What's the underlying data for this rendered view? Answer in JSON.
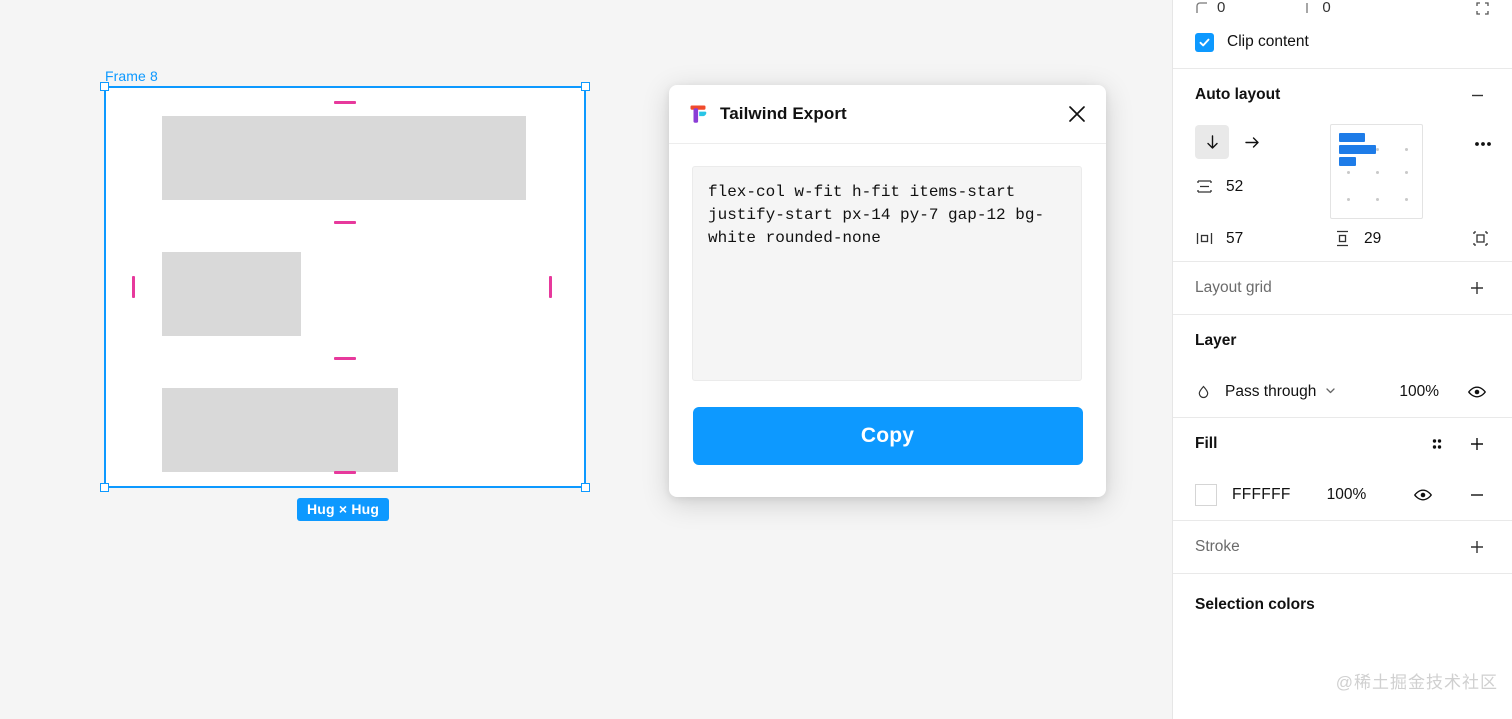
{
  "canvas": {
    "frame_label": "Frame 8",
    "hug_badge": "Hug × Hug",
    "selection_color": "#0D99FF",
    "padding_marker_color": "#E7399C",
    "block_color": "#D9D9D9",
    "background": "#F5F5F5"
  },
  "dialog": {
    "title": "Tailwind Export",
    "logo_icon": "tailwind-export-logo-icon",
    "close_icon": "close-icon",
    "code": "flex-col w-fit h-fit items-start justify-start px-14 py-7 gap-12 bg-white rounded-none",
    "copy_label": "Copy",
    "copy_color": "#0D99FF"
  },
  "panel": {
    "clipped_top": {
      "corner_radius_value": "0",
      "individual_corners_value": "0",
      "corner_icon": "corner-radius-icon",
      "side_icon": "individual-corners-icon",
      "expand_icon": "expand-corners-icon"
    },
    "clip_content": {
      "label": "Clip content",
      "checked": true,
      "check_icon": "check-icon",
      "accent": "#0D99FF"
    },
    "auto_layout": {
      "title": "Auto layout",
      "remove_icon": "minus-icon",
      "direction_vertical_icon": "arrow-down-icon",
      "direction_horizontal_icon": "arrow-right-icon",
      "direction_active": "vertical",
      "gap_icon": "gap-spacing-icon",
      "gap_value": "52",
      "padding_horizontal_icon": "horizontal-padding-icon",
      "padding_horizontal_value": "57",
      "padding_vertical_icon": "vertical-padding-icon",
      "padding_vertical_value": "29",
      "padding_all_icon": "all-padding-icon",
      "more_icon": "more-options-icon",
      "alignment_icon": "alignment-grid",
      "alignment_selected": "top-left"
    },
    "layout_grid": {
      "title": "Layout grid",
      "add_icon": "plus-icon"
    },
    "layer": {
      "title": "Layer",
      "blend_icon": "blend-mode-icon",
      "blend_mode": "Pass through",
      "chevron_icon": "chevron-down-icon",
      "opacity": "100%",
      "visibility_icon": "eye-icon"
    },
    "fill": {
      "title": "Fill",
      "styles_icon": "styles-grid-icon",
      "add_icon": "plus-icon",
      "swatch_icon": "color-swatch",
      "hex": "FFFFFF",
      "opacity": "100%",
      "visibility_icon": "eye-icon",
      "remove_icon": "minus-icon"
    },
    "stroke": {
      "title": "Stroke",
      "add_icon": "plus-icon"
    },
    "selection_colors": {
      "title": "Selection colors"
    },
    "watermark": "@稀土掘金技术社区"
  }
}
